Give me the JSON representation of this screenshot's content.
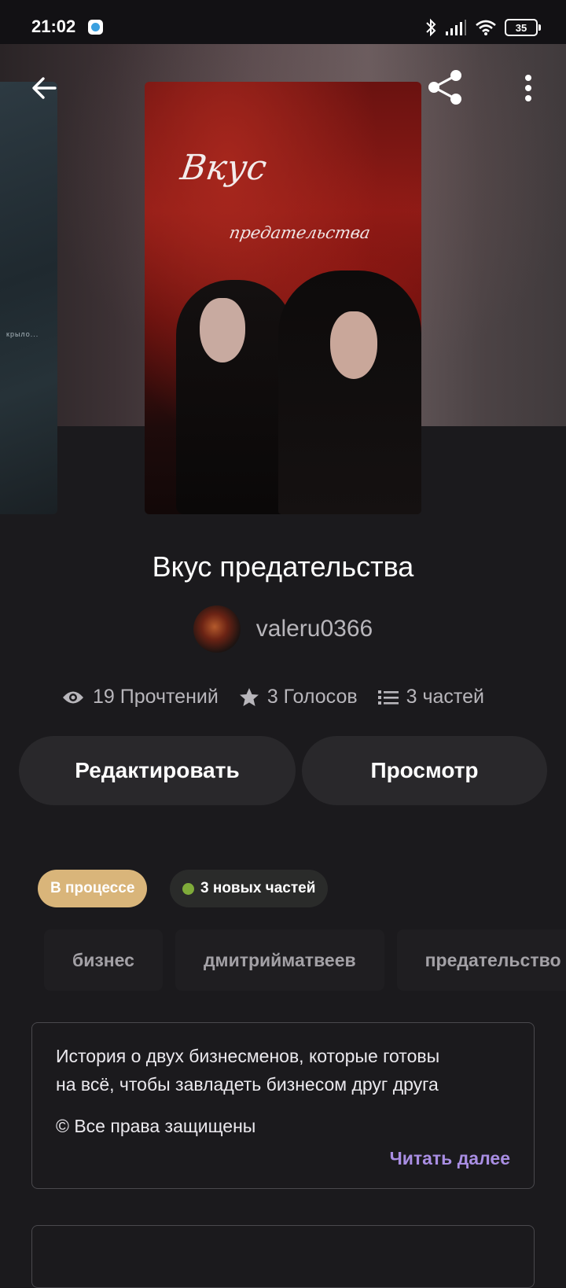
{
  "status_bar": {
    "time": "21:02",
    "battery": "35",
    "icons": [
      "app-notification-icon",
      "bluetooth-icon",
      "signal-icon",
      "wifi-icon",
      "battery-icon"
    ]
  },
  "cover": {
    "title_line1": "Вкус",
    "title_line2": "предательства",
    "side_text": "крыло..."
  },
  "story": {
    "title": "Вкус предательства",
    "author": "valeru0366"
  },
  "stats": {
    "reads": "19 Прочтений",
    "votes": "3 Голосов",
    "parts": "3 частей"
  },
  "actions": {
    "edit": "Редактировать",
    "preview": "Просмотр"
  },
  "badges": {
    "status": "В процессе",
    "new_parts": "3 новых частей"
  },
  "tags": [
    "бизнес",
    "дмитрийматвеев",
    "предательство"
  ],
  "description": {
    "text": "История о двух бизнесменов, которые готовы\nна всё, чтобы завладеть бизнесом друг друга",
    "copyright": "© Все права защищены",
    "read_more": "Читать далее"
  },
  "colors": {
    "background": "#1b1a1d",
    "status_badge": "#d9b57a",
    "new_dot": "#7fab3a",
    "accent_link": "#a98ee3"
  }
}
